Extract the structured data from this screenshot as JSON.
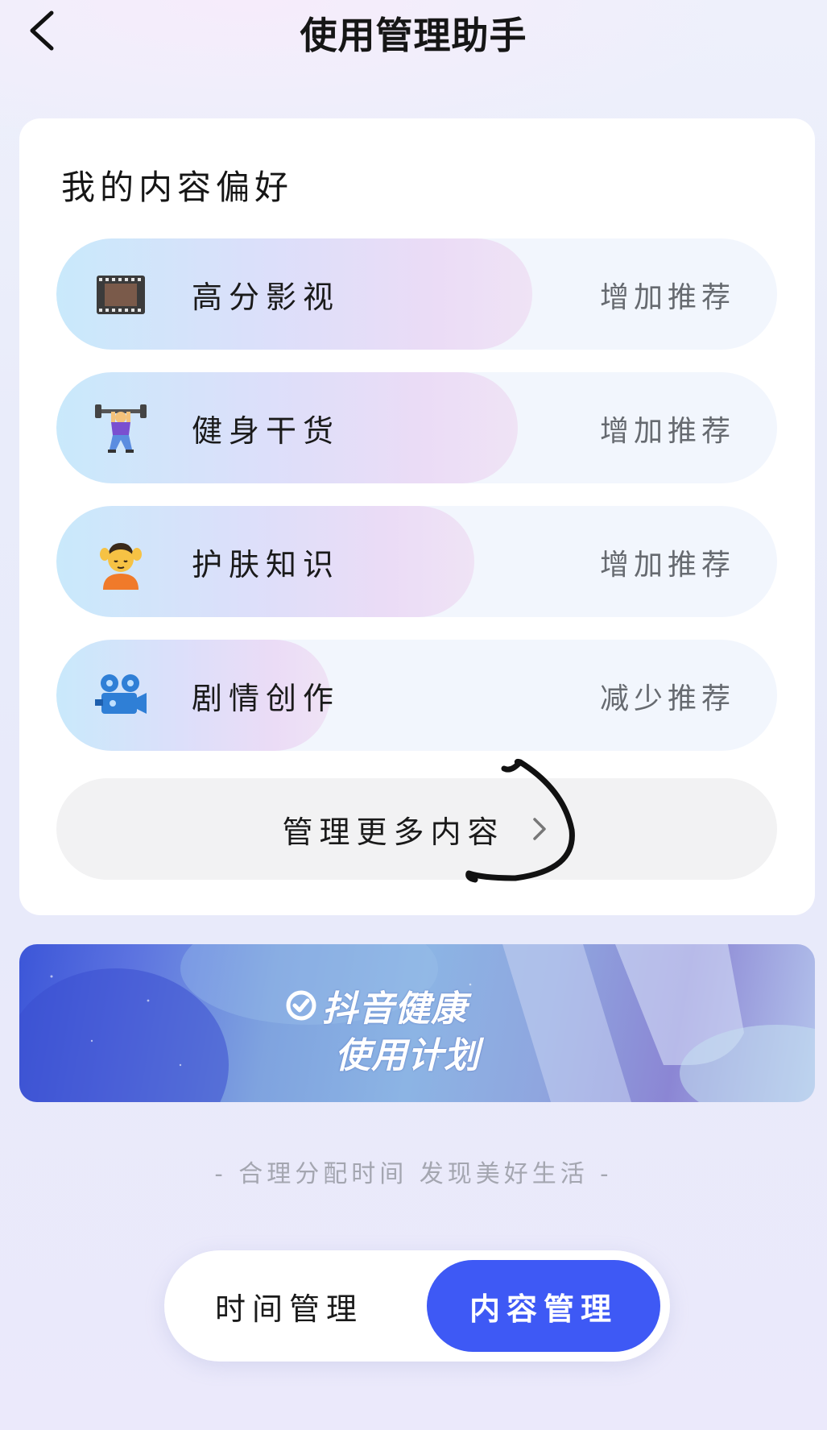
{
  "header": {
    "title": "使用管理助手",
    "back_icon": "chevron-left-icon"
  },
  "preferences": {
    "title": "我的内容偏好",
    "items": [
      {
        "label": "高分影视",
        "action": "增加推荐",
        "icon": "film-strip-icon",
        "level": 0.66
      },
      {
        "label": "健身干货",
        "action": "增加推荐",
        "icon": "weightlifter-icon",
        "level": 0.64
      },
      {
        "label": "护肤知识",
        "action": "增加推荐",
        "icon": "face-massage-icon",
        "level": 0.58
      },
      {
        "label": "剧情创作",
        "action": "减少推荐",
        "icon": "movie-camera-icon",
        "level": 0.38
      }
    ],
    "manage_more": {
      "label": "管理更多内容",
      "icon": "chevron-right-icon"
    }
  },
  "banner": {
    "line1": "抖音健康",
    "line2": "使用计划",
    "icon": "check-circle-icon"
  },
  "slogan": "- 合理分配时间 发现美好生活 -",
  "tabs": {
    "time": "时间管理",
    "content": "内容管理",
    "active": "content",
    "active_color": "#3e59f5"
  }
}
